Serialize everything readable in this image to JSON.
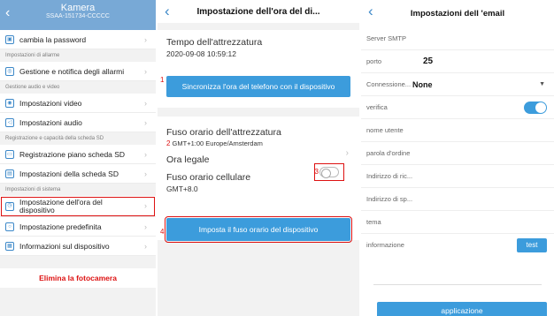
{
  "panel1": {
    "title": "Kamera",
    "subtitle": "SSAA-151734-CCCCC",
    "back_icon": "‹",
    "top_item": "cambia la password",
    "section_alarm": "Impostazioni di allarme",
    "item_alarm": "Gestione e notifica degli allarmi",
    "section_av": "Gestione audio e video",
    "item_video": "Impostazioni video",
    "item_audio": "Impostazioni audio",
    "section_sd": "Registrazione e capacità della scheda SD",
    "item_sd_plan": "Registrazione piano scheda SD",
    "item_sd": "Impostazioni della scheda SD",
    "section_system": "Impostazioni di sistema",
    "item_time": "Impostazione dell'ora del dispositivo",
    "item_default": "Impostazione predefinita",
    "item_info": "Informazioni sul dispositivo",
    "delete_label": "Elimina la fotocamera"
  },
  "panel2": {
    "title": "Impostazione dell'ora del di...",
    "device_time_label": "Tempo dell'attrezzatura",
    "device_time_value": "2020-09-08 10:59:12",
    "sync_button": "Sincronizza l'ora del telefono con il dispositivo",
    "tz_label": "Fuso orario dell'attrezzatura",
    "tz_value": "GMT+1:00 Europe/Amsterdam",
    "dst_label": "Ora legale",
    "phone_tz_label": "Fuso orario cellulare",
    "phone_tz_value": "GMT+8.0",
    "set_tz_button": "Imposta il fuso orario del dispositivo",
    "marker1": "1",
    "marker2": "2",
    "marker3": "3",
    "marker4": "4"
  },
  "panel3": {
    "title": "Impostazioni dell 'email",
    "smtp_label": "Server SMTP",
    "port_label": "porto",
    "port_value": "25",
    "conn_label": "Connessione...",
    "conn_value": "None",
    "verify_label": "verifica",
    "user_label": "nome utente",
    "pass_label": "parola d'ordine",
    "recv_label": "Indirizzo di ric...",
    "send_label": "Indirizzo di sp...",
    "subject_label": "tema",
    "info_label": "informazione",
    "test_button": "test",
    "apply_button": "applicazione"
  }
}
